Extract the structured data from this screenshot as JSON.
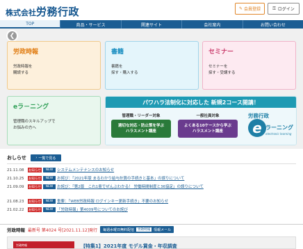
{
  "header": {
    "logo_small": "株式会社",
    "logo_big": "労務行政",
    "register_label": "会員登録",
    "login_label": "ログイン"
  },
  "nav": {
    "items": [
      "TOP",
      "商品・サービス",
      "関連サイト",
      "会社案内",
      "お問い合わせ"
    ],
    "active": "TOP"
  },
  "cards": {
    "rodo_jiho": {
      "title": "労政時報",
      "desc1": "労政時報を",
      "desc2": "購読する"
    },
    "shoseki": {
      "title": "書籍",
      "desc1": "書籍を",
      "desc2": "探す・購入する"
    },
    "seminar": {
      "title": "セミナー",
      "desc1": "セミナーを",
      "desc2": "探す・受講する"
    },
    "elearning": {
      "title": "eラ－ニング",
      "desc1": "管理職のスキルアップで",
      "desc2": "お悩みの方へ"
    }
  },
  "banner": {
    "headline": "パワハラ法制化に対応した 新規2コース開講！",
    "col1_label": "管理職・リーダー対象",
    "col1_button_line1": "適切な対応・防止策を学ぶ",
    "col1_button_line2": "ハラスメント講座",
    "col2_label": "一般社員対象",
    "col2_button_line1": "よくある10ケースから学ぶ",
    "col2_button_line2": "ハラスメント講座",
    "logo_line1": "労務行政",
    "logo_e": "e",
    "logo_line2": "ラーニング",
    "logo_line3": "electronic learning"
  },
  "news": {
    "title": "おしらせ",
    "list_button": "一覧で見る",
    "badge_label": "お知らせ",
    "new_label": "NEW",
    "items": [
      {
        "date": "21.11.08",
        "text": "システムメンテナンスのお知らせ"
      },
      {
        "date": "21.10.25",
        "text": "お詫び：「2021年版 まるわかり給与計算の手続きと基本」の誤りについて"
      },
      {
        "date": "21.09.09",
        "text": "お詫び：「第2版　これ1冊でぜんぶわかる！ 労働時間制度と36協定」の誤りについて"
      },
      {
        "date": "21.08.23",
        "text": "重要：「WEB労政時報 ログインキー更新手続き」不要のお知らせ"
      },
      {
        "date": "21.02.22",
        "text": "「労政時報」第4009号についてのお詫び"
      }
    ]
  },
  "rodo": {
    "title": "労政時報",
    "issue": "最新号 第4024 号[2021.11.12]発行",
    "mail_label": "毎週水曜日無料配信",
    "mail_sub": "労政時報",
    "mail_tail": "情報メール"
  },
  "feature": {
    "thumb_text": "労政時報",
    "title": "【特集1】2021年度 モデル賃金・年収調査"
  },
  "colors": {
    "brand": "#1b5d93",
    "orange": "#e07b10",
    "blue": "#1c8fc1",
    "pink": "#c93b6b",
    "green": "#2f9f57",
    "teal": "#1e9ab3",
    "red": "#d02b2b"
  },
  "icons": {
    "register": "pencil-icon",
    "login": "key-icon",
    "prev": "chevron-left-icon"
  }
}
